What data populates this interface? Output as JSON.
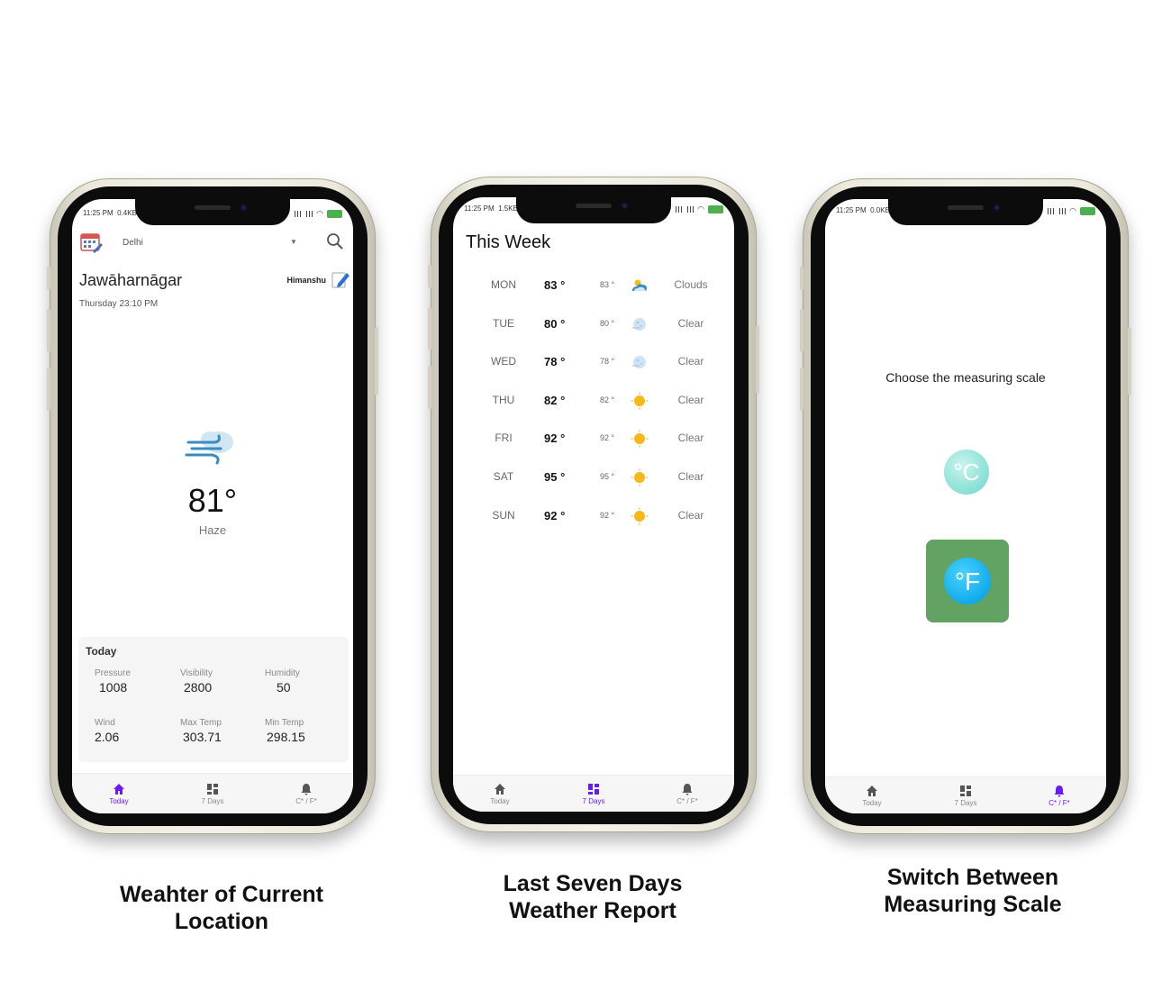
{
  "status_bar": {
    "time": "11:25 PM",
    "speeds": [
      "0.4KB/s",
      "1.5KB/s",
      "0.0KB/s"
    ]
  },
  "bottom_nav": {
    "today_label": "Today",
    "week_label": "7 Days",
    "scale_label": "C* / F*"
  },
  "screen1": {
    "city_selected": "Delhi",
    "location": "Jawāharnāgar",
    "datetime": "Thursday  23:10 PM",
    "user": "Himanshu",
    "temperature": "81°",
    "condition": "Haze",
    "card": {
      "title": "Today",
      "items": [
        {
          "label": "Pressure",
          "value": "1008"
        },
        {
          "label": "Visibility",
          "value": "2800"
        },
        {
          "label": "Humidity",
          "value": "50"
        },
        {
          "label": "Wind",
          "value": "2.06"
        },
        {
          "label": "Max Temp",
          "value": "303.71"
        },
        {
          "label": "Min Temp",
          "value": "298.15"
        }
      ]
    }
  },
  "screen2": {
    "title": "This Week",
    "days": [
      {
        "day": "MON",
        "high": "83 °",
        "low": "83 °",
        "icon": "cloud-sun-icon",
        "condition": "Clouds"
      },
      {
        "day": "TUE",
        "high": "80 °",
        "low": "80 °",
        "icon": "moon-icon",
        "condition": "Clear"
      },
      {
        "day": "WED",
        "high": "78 °",
        "low": "78 °",
        "icon": "moon-icon",
        "condition": "Clear"
      },
      {
        "day": "THU",
        "high": "82 °",
        "low": "82 °",
        "icon": "sun-icon",
        "condition": "Clear"
      },
      {
        "day": "FRI",
        "high": "92 °",
        "low": "92 °",
        "icon": "sun-icon",
        "condition": "Clear"
      },
      {
        "day": "SAT",
        "high": "95 °",
        "low": "95 °",
        "icon": "sun-icon",
        "condition": "Clear"
      },
      {
        "day": "SUN",
        "high": "92 °",
        "low": "92 °",
        "icon": "sun-icon",
        "condition": "Clear"
      }
    ]
  },
  "screen3": {
    "title": "Choose the measuring scale",
    "celsius_symbol": "°C",
    "fahrenheit_symbol": "°F",
    "selected": "fahrenheit"
  },
  "captions": {
    "c1_line1": "Weahter of Current",
    "c1_line2": "Location",
    "c2_line1": "Last Seven Days",
    "c2_line2": "Weather Report",
    "c3_line1": "Switch Between",
    "c3_line2": "Measuring Scale"
  },
  "colors": {
    "accent": "#6a1bf5",
    "selected_bg": "#62a263",
    "sun": "#f6b81a",
    "card": "#f5f5f5"
  }
}
